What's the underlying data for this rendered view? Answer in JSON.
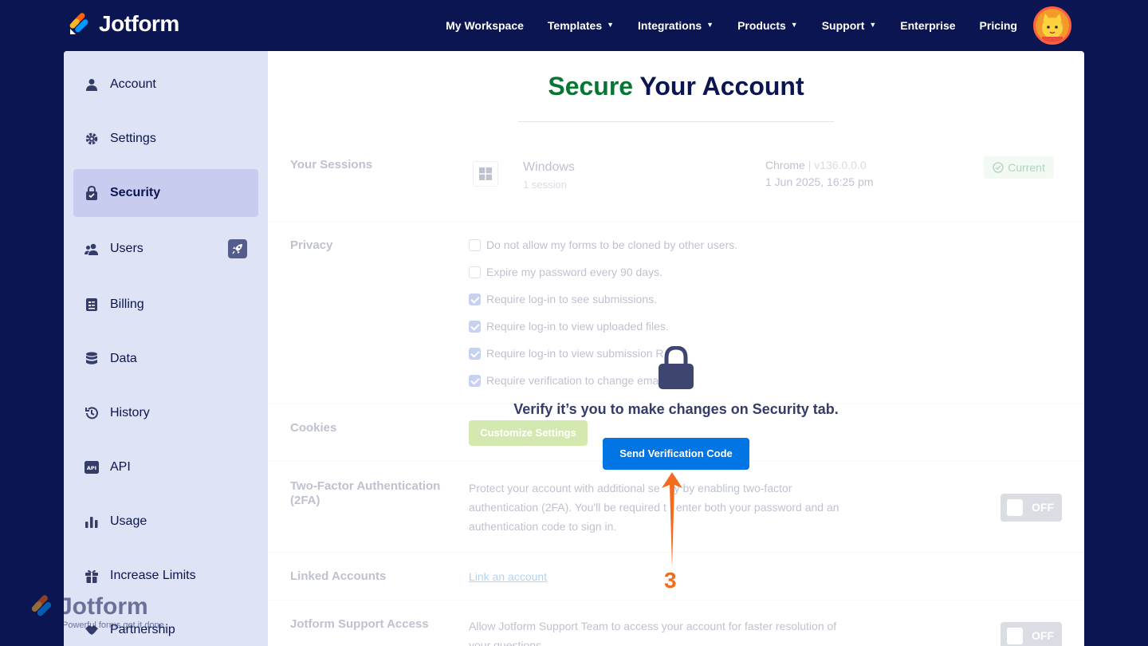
{
  "brand": {
    "name": "Jotform"
  },
  "nav": {
    "items": [
      {
        "label": "My Workspace",
        "dropdown": false
      },
      {
        "label": "Templates",
        "dropdown": true
      },
      {
        "label": "Integrations",
        "dropdown": true
      },
      {
        "label": "Products",
        "dropdown": true
      },
      {
        "label": "Support",
        "dropdown": true
      },
      {
        "label": "Enterprise",
        "dropdown": false
      },
      {
        "label": "Pricing",
        "dropdown": false
      }
    ]
  },
  "sidebar": {
    "items": [
      {
        "label": "Account",
        "icon": "user-icon",
        "active": false
      },
      {
        "label": "Settings",
        "icon": "gear-icon",
        "active": false
      },
      {
        "label": "Security",
        "icon": "shield-lock-icon",
        "active": true
      },
      {
        "label": "Users",
        "icon": "users-icon",
        "active": false
      },
      {
        "label": "Billing",
        "icon": "billing-icon",
        "active": false
      },
      {
        "label": "Data",
        "icon": "database-icon",
        "active": false
      },
      {
        "label": "History",
        "icon": "history-icon",
        "active": false
      },
      {
        "label": "API",
        "icon": "api-icon",
        "active": false
      },
      {
        "label": "Usage",
        "icon": "bar-chart-icon",
        "active": false
      },
      {
        "label": "Increase Limits",
        "icon": "gift-icon",
        "active": false
      },
      {
        "label": "Partnership",
        "icon": "handshake-icon",
        "active": false
      }
    ]
  },
  "page": {
    "title_accent": "Secure",
    "title_rest": "Your Account"
  },
  "sessions": {
    "label": "Your Sessions",
    "os": "Windows",
    "count": "1 session",
    "browser": "Chrome",
    "version": "v136.0.0.0",
    "time": "1 Jun 2025, 16:25 pm",
    "badge": "Current"
  },
  "privacy": {
    "label": "Privacy",
    "options": [
      {
        "label": "Do not allow my forms to be cloned by other users.",
        "checked": false
      },
      {
        "label": "Expire my password every 90 days.",
        "checked": false
      },
      {
        "label": "Require log-in to see submissions.",
        "checked": true
      },
      {
        "label": "Require log-in to view uploaded files.",
        "checked": true
      },
      {
        "label": "Require log-in to view submission R",
        "checked": true
      },
      {
        "label": "Require verification to change ema",
        "checked": true
      }
    ]
  },
  "cookies": {
    "label": "Cookies",
    "button": "Customize Settings"
  },
  "twofa": {
    "label_line1": "Two-Factor Authentication",
    "label_line2": "(2FA)",
    "desc_line1": "Protect your account with additional se",
    "desc_line1b": "ty by enabling two-factor",
    "desc_line2": "authentication (2FA). You'll be required t",
    "desc_line2b": "enter both your password and an",
    "desc_line3": "authentication code to sign in.",
    "toggle": "OFF"
  },
  "linked": {
    "label": "Linked Accounts",
    "link": "Link an account"
  },
  "support_access": {
    "label": "Jotform Support Access",
    "desc_line1": "Allow Jotform Support Team to access your account for faster resolution of",
    "desc_line2": "your questions.",
    "toggle": "OFF"
  },
  "overlay": {
    "message": "Verify it’s you to make changes on Security tab.",
    "button": "Send Verification Code"
  },
  "annotation": {
    "step": "3",
    "color": "#f36c1e"
  },
  "watermark": {
    "name": "Jotform",
    "tagline": "Powerful forms get it done."
  },
  "colors": {
    "nav_bg": "#0a1551",
    "accent_green": "#097533",
    "primary_blue": "#0075e3"
  }
}
